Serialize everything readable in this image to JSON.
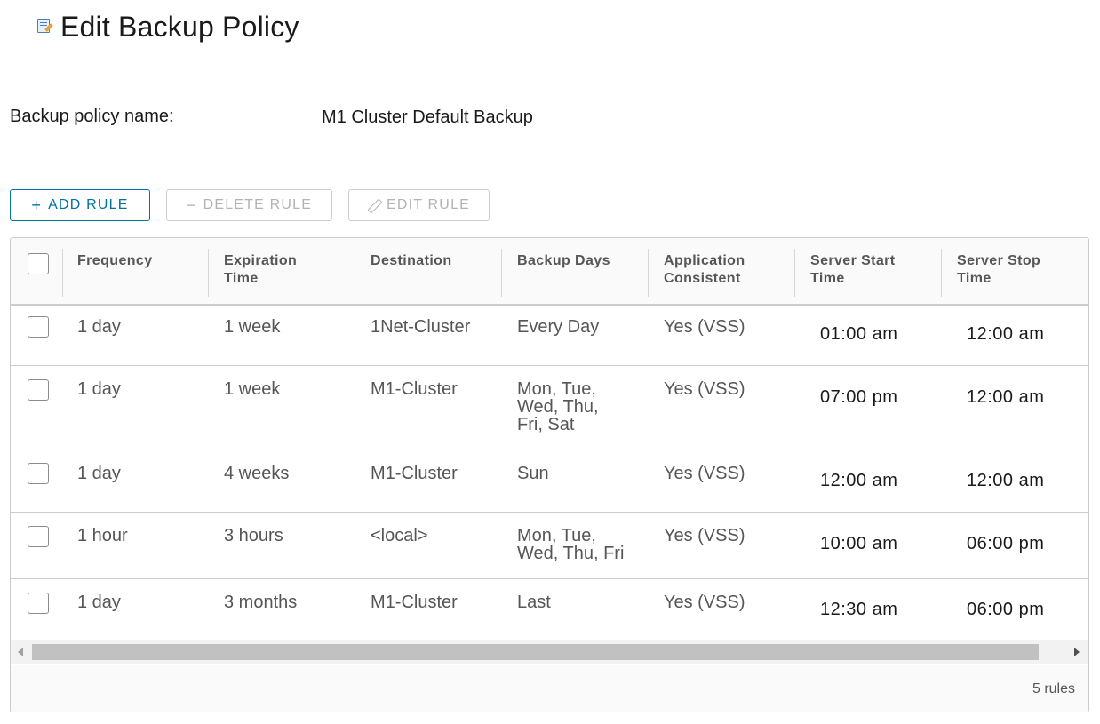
{
  "page": {
    "title": "Edit Backup Policy",
    "icon": "edit-policy-icon"
  },
  "form": {
    "name_label": "Backup policy name:",
    "name_value": "M1 Cluster Default Backup"
  },
  "toolbar": {
    "add_label": "ADD RULE",
    "add_icon": "+",
    "delete_label": "DELETE RULE",
    "delete_icon": "−",
    "edit_label": "EDIT RULE"
  },
  "table": {
    "headers": {
      "frequency": "Frequency",
      "expiration_1": "Expiration",
      "expiration_2": "Time",
      "destination": "Destination",
      "backup_days": "Backup Days",
      "app_consistent_1": "Application",
      "app_consistent_2": "Consistent",
      "start_1": "Server Start",
      "start_2": "Time",
      "stop_1": "Server Stop",
      "stop_2": "Time"
    },
    "rows": [
      {
        "frequency": "1 day",
        "expiration": "1 week",
        "destination": "1Net-Cluster",
        "days": [
          "Every Day"
        ],
        "app": "Yes (VSS)",
        "start": "01:00 am",
        "stop": "12:00 am"
      },
      {
        "frequency": "1 day",
        "expiration": "1 week",
        "destination": "M1-Cluster",
        "days": [
          "Mon, Tue,",
          "Wed, Thu,",
          "Fri, Sat"
        ],
        "app": "Yes (VSS)",
        "start": "07:00 pm",
        "stop": "12:00 am"
      },
      {
        "frequency": "1 day",
        "expiration": "4 weeks",
        "destination": "M1-Cluster",
        "days": [
          "Sun"
        ],
        "app": "Yes (VSS)",
        "start": "12:00 am",
        "stop": "12:00 am"
      },
      {
        "frequency": "1 hour",
        "expiration": "3 hours",
        "destination": "<local>",
        "days": [
          "Mon, Tue,",
          "Wed, Thu, Fri"
        ],
        "app": "Yes (VSS)",
        "start": "10:00 am",
        "stop": "06:00 pm"
      },
      {
        "frequency": "1 day",
        "expiration": "3 months",
        "destination": "M1-Cluster",
        "days": [
          "Last"
        ],
        "app": "Yes (VSS)",
        "start": "12:30 am",
        "stop": "06:00 pm"
      }
    ],
    "footer_count": "5 rules"
  },
  "colors": {
    "accent": "#0072a3",
    "disabled": "#b3b3b3",
    "border": "#cccccc"
  }
}
